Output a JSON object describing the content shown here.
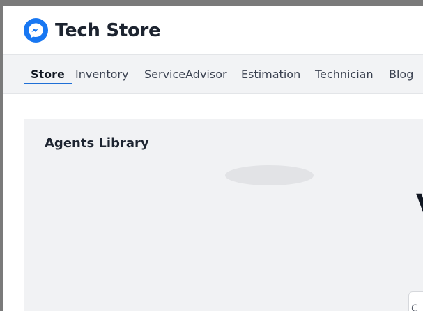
{
  "header": {
    "logo_icon": "messenger-icon",
    "title": "Tech Store",
    "brand_color": "#1877f2"
  },
  "nav": {
    "tabs": [
      {
        "label": "Store",
        "active": true
      },
      {
        "label": "Inventory",
        "active": false
      },
      {
        "label": "ServiceAdvisor",
        "active": false
      },
      {
        "label": "Estimation",
        "active": false
      },
      {
        "label": "Technician",
        "active": false
      },
      {
        "label": "Blog",
        "active": false
      }
    ],
    "active_color": "#1f6fd6"
  },
  "main": {
    "heading": "Agents Library",
    "partial_glyph": "V",
    "corner_card_glyph": "C"
  }
}
